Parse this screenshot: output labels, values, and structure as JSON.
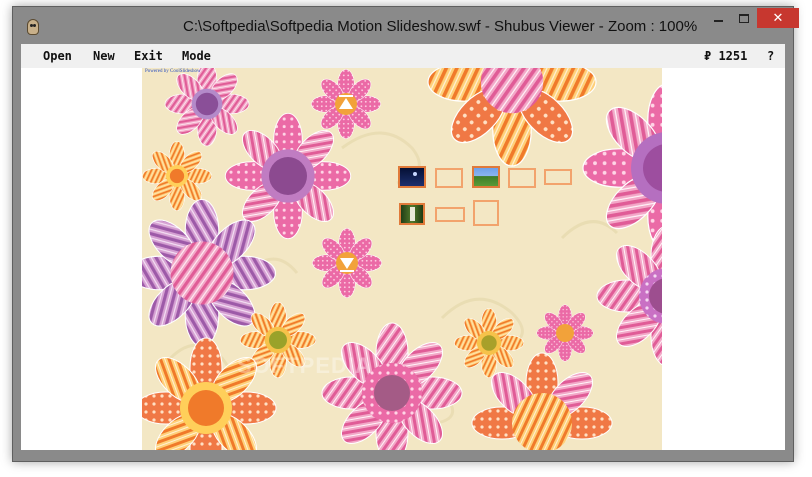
{
  "window": {
    "title": "C:\\Softpedia\\Softpedia Motion Slideshow.swf - Shubus Viewer - Zoom : 100%",
    "close_glyph": "✕"
  },
  "menu": {
    "open": "Open",
    "new": "New",
    "exit": "Exit",
    "mode": "Mode",
    "frame_counter": "₽ 1251",
    "help": "?"
  },
  "stage": {
    "powered_by": "Powered by CoolSlideshow",
    "watermark": "SOFTPEDIA",
    "thumbnails": [
      {
        "name": "thumbnail-1",
        "state": "image",
        "scene": "night"
      },
      {
        "name": "thumbnail-2",
        "state": "empty"
      },
      {
        "name": "thumbnail-3",
        "state": "image",
        "scene": "field"
      },
      {
        "name": "thumbnail-4",
        "state": "empty"
      },
      {
        "name": "thumbnail-5",
        "state": "empty"
      },
      {
        "name": "thumbnail-6",
        "state": "image",
        "scene": "forest"
      },
      {
        "name": "thumbnail-7",
        "state": "empty"
      },
      {
        "name": "thumbnail-8",
        "state": "empty"
      }
    ],
    "nav": {
      "up_icon": "up-arrow-icon",
      "down_icon": "down-arrow-icon"
    }
  },
  "colors": {
    "titlebar": "#8a8a8a",
    "close_button": "#c7372f",
    "stage_background": "#f3e7c4",
    "thumb_border": "#f2a36c"
  }
}
